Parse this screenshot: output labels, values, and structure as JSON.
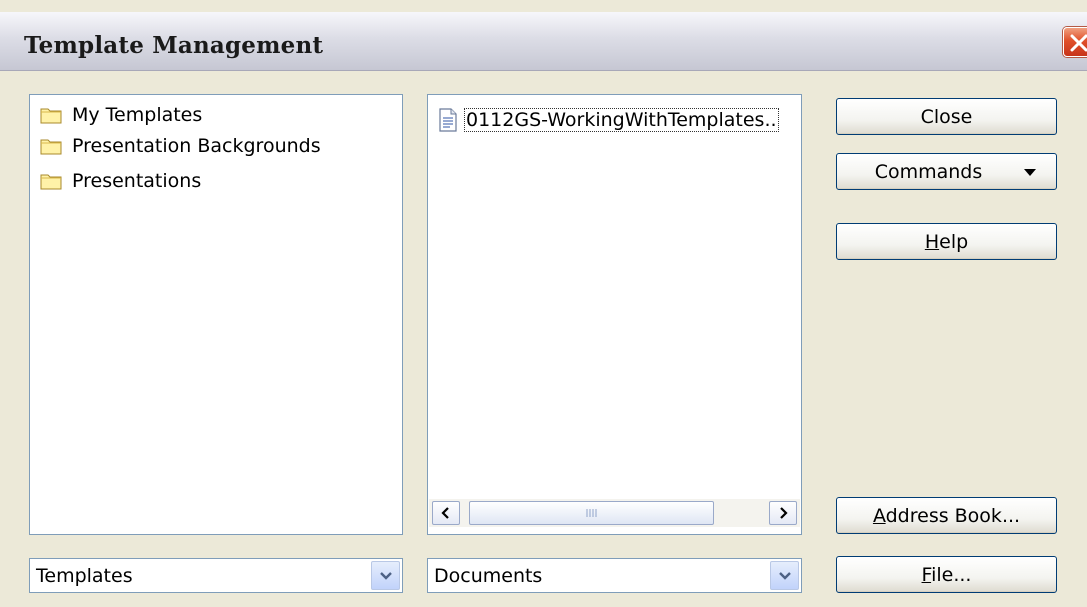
{
  "window": {
    "title": "Template Management"
  },
  "categories": {
    "items": [
      {
        "label": "My Templates",
        "icon": "folder-icon"
      },
      {
        "label": "Presentation Backgrounds",
        "icon": "folder-icon"
      },
      {
        "label": "Presentations",
        "icon": "folder-icon"
      }
    ],
    "source": {
      "value": "Templates"
    }
  },
  "documents": {
    "items": [
      {
        "label": "0112GS-WorkingWithTemplates..",
        "icon": "document-icon"
      }
    ],
    "source": {
      "value": "Documents"
    }
  },
  "buttons": {
    "close": "Close",
    "commands": "Commands",
    "help": {
      "mnemonic": "H",
      "rest": "elp"
    },
    "address_book": {
      "mnemonic": "A",
      "rest": "ddress Book..."
    },
    "file": {
      "mnemonic": "F",
      "rest": "ile..."
    }
  },
  "colors": {
    "accent": "#003c74",
    "titlebar": "#dcdde6",
    "close_red": "#e0502a"
  }
}
